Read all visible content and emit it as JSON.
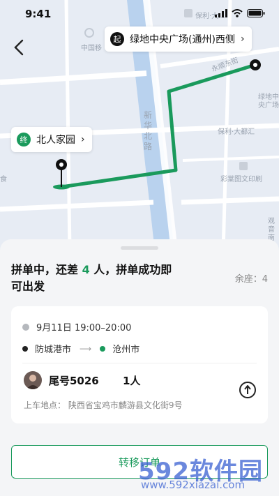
{
  "status_bar": {
    "time": "9:41"
  },
  "map": {
    "start": {
      "badge": "起",
      "label": "绿地中央广场(通州)西侧"
    },
    "end": {
      "badge": "终",
      "label": "北人家园"
    },
    "labels": {
      "poi_top": "保利·大...",
      "china_mobile": "中国移",
      "road_yongshun": "永顺东街",
      "road_xinhua": "新华北路",
      "greenland": "绿地中央广场",
      "poly": "保利·大都汇",
      "print": "彩棠图文印刷",
      "food": "食",
      "south": "观音南街"
    },
    "route_color": "#1a9a5c"
  },
  "sheet": {
    "headline_part1": "拼单中，还差 ",
    "headline_num": "4",
    "headline_part2": " 人，拼单成功即可出发",
    "seats": "余座：4",
    "trip": {
      "datetime": "9月11日  19:00–20:00",
      "from": "防城港市",
      "to": "沧州市",
      "plate": "尾号5026",
      "count": "1人",
      "pickup": "上车地点：  陕西省宝鸡市麟游县文化街9号"
    },
    "transfer_button": "转移订单"
  },
  "watermark": {
    "brand": "592软件园",
    "url": "www.592xiazai.com"
  }
}
